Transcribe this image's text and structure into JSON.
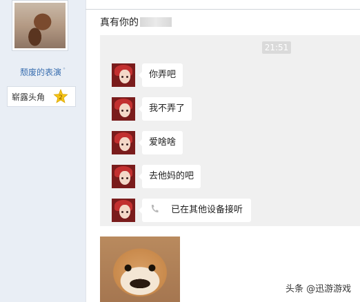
{
  "sidebar": {
    "username": "颓废的表演",
    "badge": {
      "label": "崭露头角",
      "level": "2"
    }
  },
  "post": {
    "caption": "真有你的"
  },
  "chat": {
    "time": "21:51",
    "messages": [
      {
        "text": "你弄吧"
      },
      {
        "text": "我不弄了"
      },
      {
        "text": "爱啥啥"
      },
      {
        "text": "去他妈的吧"
      },
      {
        "text": "已在其他设备接听",
        "icon": "phone-icon"
      }
    ]
  },
  "watermark": "头条 @迅游游戏",
  "colors": {
    "sidebar_bg": "#e9eef5",
    "username": "#3a6fb0",
    "chat_bg": "#f0f0f0",
    "badge_star": "#f5c518"
  }
}
